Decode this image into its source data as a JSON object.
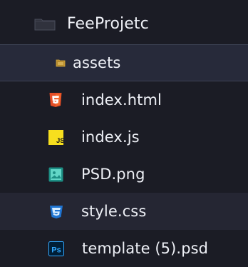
{
  "explorer": {
    "root_folder": {
      "label": "FeeProjetc",
      "icon": "folder-icon"
    },
    "items": [
      {
        "label": "assets",
        "type": "folder",
        "icon": "folder-icon",
        "selected": true
      },
      {
        "label": "index.html",
        "type": "file",
        "icon": "html5-icon",
        "icon_color": "#e44d26"
      },
      {
        "label": "index.js",
        "type": "file",
        "icon": "js-icon",
        "icon_color": "#f7df1e"
      },
      {
        "label": "PSD.png",
        "type": "file",
        "icon": "image-icon",
        "icon_color": "#2cb7a8"
      },
      {
        "label": "style.css",
        "type": "file",
        "icon": "css3-icon",
        "icon_color": "#2f83d8",
        "hovered": true
      },
      {
        "label": "template (5).psd",
        "type": "file",
        "icon": "photoshop-icon",
        "icon_color": "#31a8ff"
      }
    ],
    "colors": {
      "background": "#1b1c25",
      "selected_background": "#272a3a",
      "text": "#eef0f6"
    },
    "icon_text": {
      "js": "JS",
      "ps": "Ps"
    }
  }
}
